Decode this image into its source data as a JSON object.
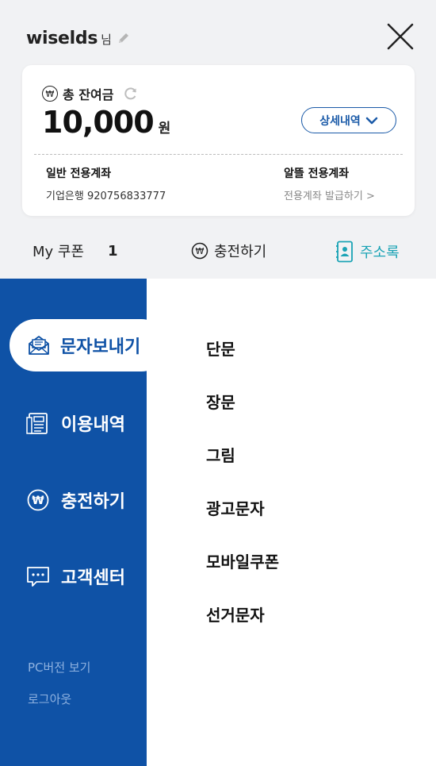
{
  "header": {
    "username": "wiselds",
    "suffix": "님",
    "icons": {
      "edit": "pencil-icon",
      "close": "close-icon"
    }
  },
  "balance_card": {
    "label": "총 잔여금",
    "currency_symbol": "₩",
    "amount": "10,000",
    "unit": "원",
    "detail_button": "상세내역",
    "general_account": {
      "title": "일반 전용계좌",
      "bank_info": "기업은행 920756833777"
    },
    "saving_account": {
      "title": "알뜰 전용계좌",
      "link": "전용계좌 발급하기 >"
    }
  },
  "quick_actions": {
    "coupon_label": "My 쿠폰",
    "coupon_count": "1",
    "charge_label": "충전하기",
    "contacts_label": "주소록"
  },
  "sidebar": {
    "items": [
      {
        "label": "문자보내기",
        "icon": "envelope-icon",
        "active": true
      },
      {
        "label": "이용내역",
        "icon": "document-icon",
        "active": false
      },
      {
        "label": "충전하기",
        "icon": "won-coin-icon",
        "active": false
      },
      {
        "label": "고객센터",
        "icon": "chat-bubble-icon",
        "active": false
      }
    ],
    "links": [
      {
        "label": "PC버전 보기"
      },
      {
        "label": "로그아웃"
      }
    ]
  },
  "submenu": {
    "items": [
      {
        "label": "단문"
      },
      {
        "label": "장문"
      },
      {
        "label": "그림"
      },
      {
        "label": "광고문자"
      },
      {
        "label": "모바일쿠폰"
      },
      {
        "label": "선거문자"
      }
    ]
  },
  "colors": {
    "primary_blue": "#0f52a6",
    "accent_teal": "#1aa3b5",
    "background": "#f1f2f4"
  }
}
